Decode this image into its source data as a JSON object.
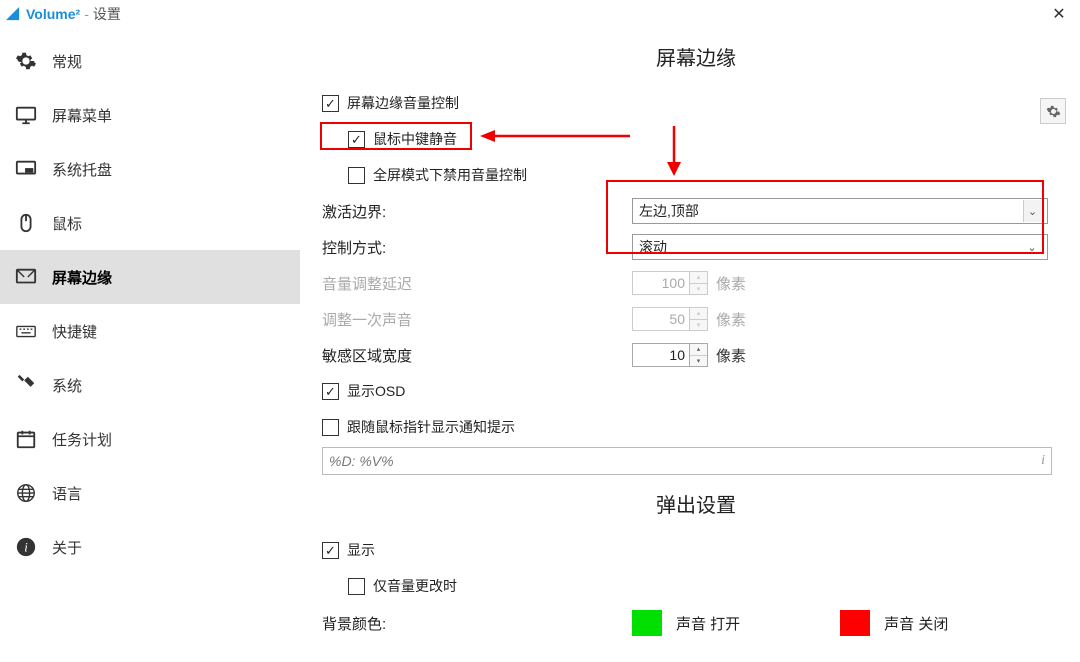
{
  "window": {
    "app_name": "Volume²",
    "separator": "-",
    "subtitle": "设置"
  },
  "sidebar": {
    "items": [
      {
        "label": "常规",
        "icon": "gear-icon"
      },
      {
        "label": "屏幕菜单",
        "icon": "monitor-icon"
      },
      {
        "label": "系统托盘",
        "icon": "tray-icon"
      },
      {
        "label": "鼠标",
        "icon": "mouse-icon"
      },
      {
        "label": "屏幕边缘",
        "icon": "edge-icon",
        "active": true
      },
      {
        "label": "快捷键",
        "icon": "keyboard-icon"
      },
      {
        "label": "系统",
        "icon": "tools-icon"
      },
      {
        "label": "任务计划",
        "icon": "calendar-icon"
      },
      {
        "label": "语言",
        "icon": "globe-icon"
      },
      {
        "label": "关于",
        "icon": "info-icon"
      }
    ]
  },
  "sections": {
    "screen_edge": {
      "title": "屏幕边缘",
      "checkbox_edge_volume_control": {
        "label": "屏幕边缘音量控制",
        "checked": true
      },
      "checkbox_middle_mute": {
        "label": "鼠标中键静音",
        "checked": true
      },
      "checkbox_fullscreen_disable": {
        "label": "全屏模式下禁用音量控制",
        "checked": false
      },
      "activate_border": {
        "label": "激活边界:",
        "value": "左边,顶部"
      },
      "control_method": {
        "label": "控制方式:",
        "value": "滚动"
      },
      "volume_delay": {
        "label": "音量调整延迟",
        "value": "100",
        "unit": "像素",
        "disabled": true
      },
      "adjust_once": {
        "label": "调整一次声音",
        "value": "50",
        "unit": "像素",
        "disabled": true
      },
      "sensitive_width": {
        "label": "敏感区域宽度",
        "value": "10",
        "unit": "像素",
        "disabled": false
      },
      "checkbox_show_osd": {
        "label": "显示OSD",
        "checked": true
      },
      "checkbox_follow_mouse": {
        "label": "跟随鼠标指针显示通知提示",
        "checked": false
      },
      "format_input": {
        "value": "%D: %V%"
      }
    },
    "popup": {
      "title": "弹出设置",
      "checkbox_show": {
        "label": "显示",
        "checked": true
      },
      "checkbox_only_change": {
        "label": "仅音量更改时",
        "checked": false
      },
      "bg_color_label": "背景颜色:",
      "sound_on_label": "声音 打开",
      "sound_off_label": "声音 关闭",
      "sound_on_color": "#00e000",
      "sound_off_color": "#ff0000"
    }
  }
}
